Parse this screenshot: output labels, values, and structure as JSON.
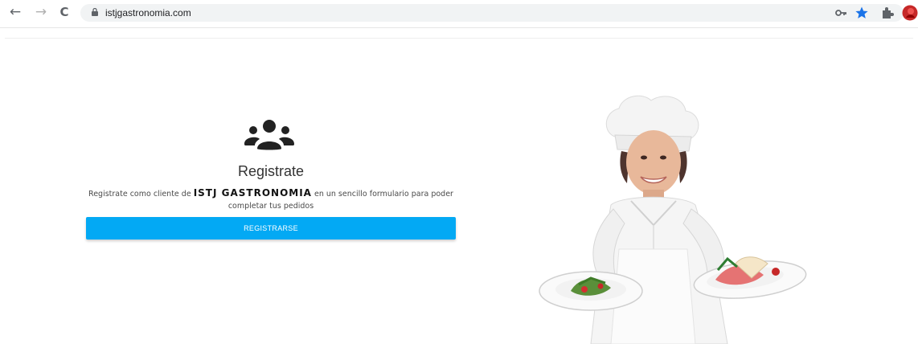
{
  "browser": {
    "url": "istjgastronomia.com",
    "nav": {
      "back": "←",
      "forward": "→",
      "reload": "C"
    },
    "icons": [
      "key-icon",
      "star-icon",
      "extensions-icon",
      "profile-avatar"
    ],
    "star_color": "#1a73e8"
  },
  "main": {
    "icon": "users-icon",
    "title": "Registrate",
    "desc_prefix": "Registrate como cliente de ",
    "brand": "ISTJ GASTRONOMIA",
    "desc_suffix": " en un sencillo formulario para poder completar tus pedidos",
    "button_label": "REGISTRARSE",
    "accent": "#03a9f4"
  },
  "hero": {
    "image": "chef-holding-plates"
  }
}
